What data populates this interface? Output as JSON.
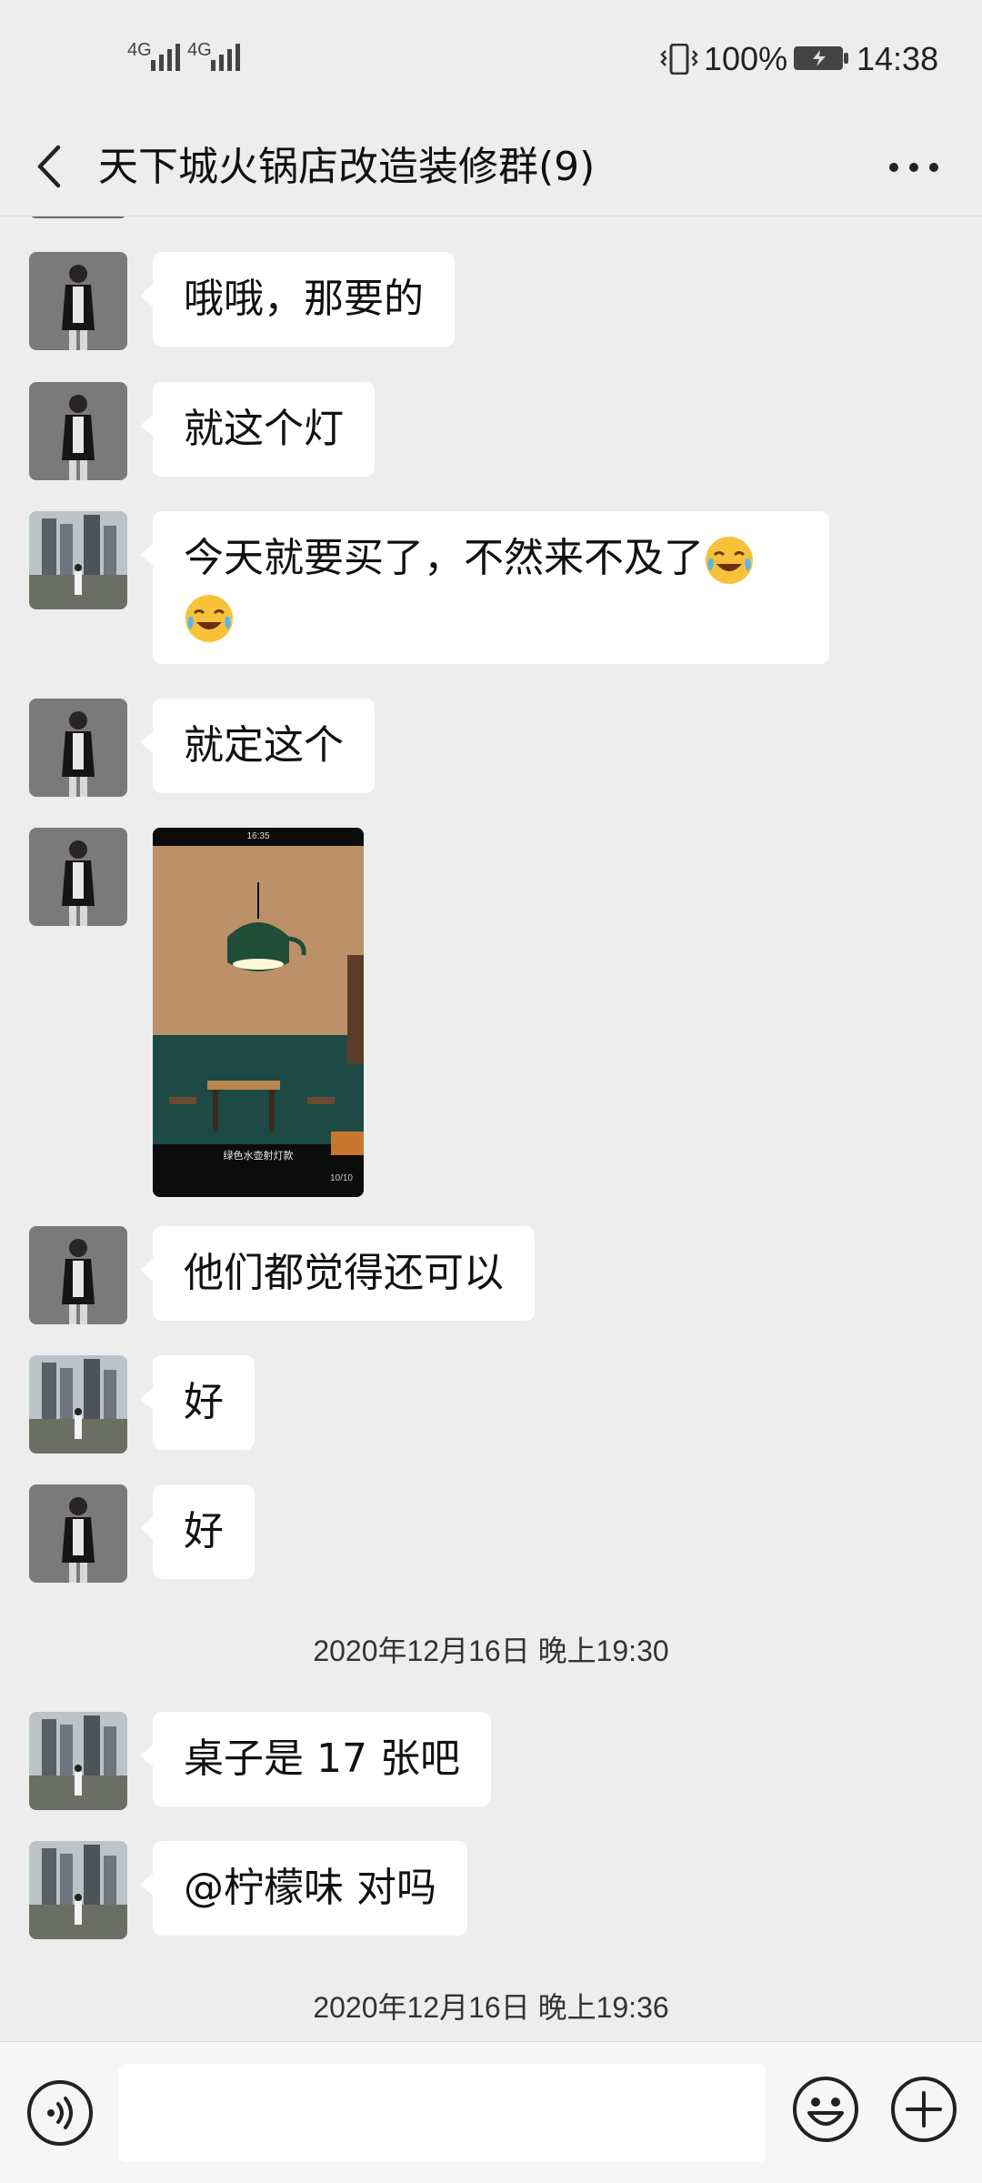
{
  "status_bar": {
    "signal1_label": "4G",
    "signal2_label": "4G",
    "battery_percent": "100%",
    "time": "14:38"
  },
  "header": {
    "title": "天下城火锅店改造装修群(9)"
  },
  "messages": [
    {
      "sender": "a",
      "text": "哦哦，那要的"
    },
    {
      "sender": "a",
      "text": "就这个灯"
    },
    {
      "sender": "b",
      "text": "今天就要买了，不然来不及了"
    },
    {
      "sender": "a",
      "text": "就定这个"
    },
    {
      "sender": "a",
      "type": "image",
      "photo_status_time": "16:35",
      "photo_caption": "绿色水壶射灯款",
      "photo_counter": "10/10"
    },
    {
      "sender": "a",
      "text": "他们都觉得还可以"
    },
    {
      "sender": "b",
      "text": "好"
    },
    {
      "sender": "a",
      "text": "好"
    },
    {
      "sender": "b",
      "text": "桌子是 17 张吧"
    },
    {
      "sender": "b",
      "text": "@柠檬味  对吗"
    }
  ],
  "timestamps": [
    "2020年12月16日 晚上19:30",
    "2020年12月16日 晚上19:36"
  ],
  "emoji": [
    "crying-laughing-emoji",
    "crying-laughing-emoji"
  ],
  "colors": {
    "background": "#ededed",
    "bubble": "#ffffff",
    "text": "#111111"
  },
  "input_bar": {
    "text_value": ""
  }
}
